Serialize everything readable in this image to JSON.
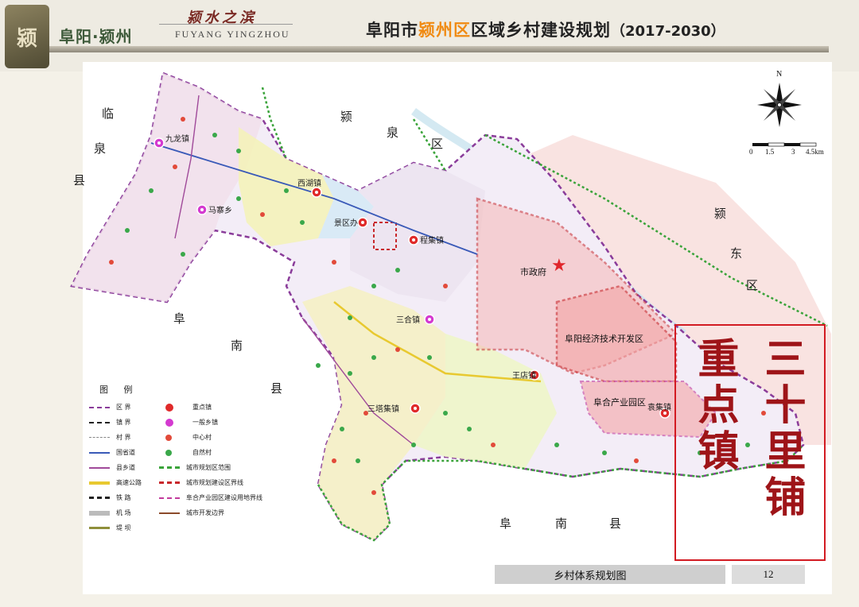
{
  "header": {
    "brand_name": "阜阳·颍州",
    "brand_slogan": "颍水之滨",
    "brand_latin": "FUYANG YINGZHOU",
    "title_prefix": "阜阳市",
    "title_accent": "颍州区",
    "title_suffix": "区域乡村建设规划",
    "title_years": "（2017-2030）",
    "accent_color": "#f08a12"
  },
  "map": {
    "region_labels": [
      "临",
      "泉",
      "县",
      "颍",
      "泉",
      "区",
      "颍",
      "东",
      "区",
      "阜",
      "南",
      "县",
      "阜",
      "南",
      "县"
    ],
    "city_hall": "市政府",
    "dev_zone": "阜阳经济技术开发区",
    "industrial_park": "阜合产业园区",
    "towns": [
      "九龙镇",
      "西湖镇",
      "三合镇",
      "王店镇",
      "三塔集镇",
      "袁集镇",
      "程集镇",
      "景区办",
      "马寨乡"
    ]
  },
  "compass": {
    "north": "N",
    "scale_labels": [
      "0",
      "1.5",
      "3",
      "4.5km"
    ]
  },
  "legend": {
    "title": "图 例",
    "left": [
      {
        "label": "区 界",
        "style": "purple-dash"
      },
      {
        "label": "镇 界",
        "style": "black-dashdot"
      },
      {
        "label": "村 界",
        "style": "grey-dash"
      },
      {
        "label": "国省道",
        "style": "blue-line"
      },
      {
        "label": "县乡道",
        "style": "purple-line"
      },
      {
        "label": "高速公路",
        "style": "yellow-line"
      },
      {
        "label": "铁 路",
        "style": "rail"
      },
      {
        "label": "机 场",
        "style": "airport"
      },
      {
        "label": "堤 坝",
        "style": "dam"
      }
    ],
    "right": [
      {
        "label": "重点镇",
        "style": "key-town"
      },
      {
        "label": "一般乡镇",
        "style": "general-town"
      },
      {
        "label": "中心村",
        "style": "center-village"
      },
      {
        "label": "自然村",
        "style": "natural-village"
      },
      {
        "label": "城市规划区范围",
        "style": "green-dash"
      },
      {
        "label": "城市规划建设区界线",
        "style": "red-dash"
      },
      {
        "label": "阜合产业园区建设用地界线",
        "style": "magenta-dash"
      },
      {
        "label": "城市开发边界",
        "style": "brown-line"
      }
    ]
  },
  "footer": {
    "caption": "乡村体系规划图",
    "page": "12"
  },
  "annotation": {
    "left_text": "重点镇",
    "right_text": "三十里铺",
    "color": "#d21b22"
  }
}
